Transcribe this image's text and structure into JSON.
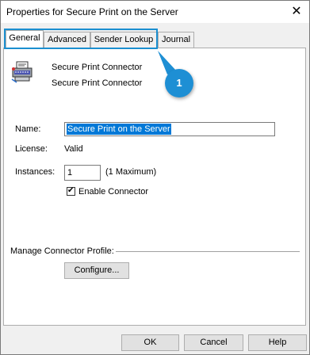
{
  "window": {
    "title": "Properties for Secure Print on the Server",
    "close_glyph": "✕"
  },
  "tabs": [
    {
      "label": "General",
      "active": true
    },
    {
      "label": "Advanced"
    },
    {
      "label": "Sender Lookup"
    },
    {
      "label": "Journal"
    }
  ],
  "callout": {
    "number": "1",
    "color": "#1e8fd4"
  },
  "connector": {
    "icon": "printer-icon",
    "name_line1": "Secure Print Connector",
    "name_line2": "Secure Print Connector"
  },
  "form": {
    "name_label": "Name:",
    "name_value": "Secure Print on the Server",
    "license_label": "License:",
    "license_value": "Valid",
    "instances_label": "Instances:",
    "instances_value": "1",
    "instances_hint": "(1 Maximum)",
    "enable_label": "Enable Connector",
    "enable_checked": true,
    "check_glyph": "✔"
  },
  "profile": {
    "label": "Manage Connector Profile:",
    "configure_button": "Configure..."
  },
  "footer": {
    "ok": "OK",
    "cancel": "Cancel",
    "help": "Help"
  }
}
